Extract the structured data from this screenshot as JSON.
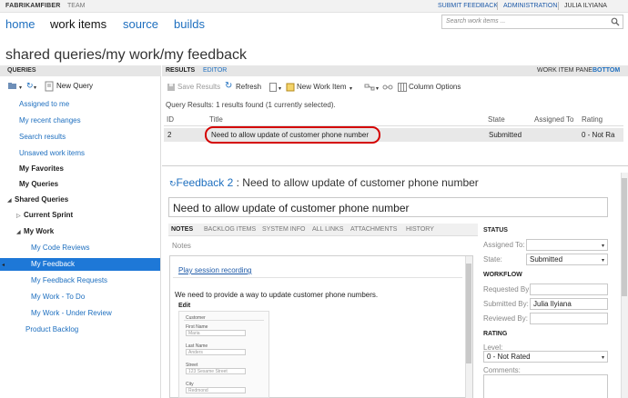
{
  "topbar": {
    "brand": "FABRIKAMFIBER",
    "team": "TEAM",
    "submit_feedback": "SUBMIT FEEDBACK",
    "administration": "ADMINISTRATION",
    "user": "JULIA ILYIANA"
  },
  "nav": {
    "tabs": [
      "home",
      "work items",
      "source",
      "builds"
    ],
    "active_tab": "work items",
    "search_placeholder": "Search work items ..."
  },
  "page_title": "shared queries/my work/my feedback",
  "queries_pane": {
    "header": "QUERIES",
    "new_query_label": "New Query",
    "items": [
      {
        "label": "Assigned to me",
        "style": "link"
      },
      {
        "label": "My recent changes",
        "style": "link"
      },
      {
        "label": "Search results",
        "style": "link"
      },
      {
        "label": "Unsaved work items",
        "style": "link"
      },
      {
        "label": "My Favorites",
        "style": "bold"
      },
      {
        "label": "My Queries",
        "style": "bold"
      },
      {
        "label": "Shared Queries",
        "style": "bold"
      },
      {
        "label": "Current Sprint",
        "style": "bold"
      },
      {
        "label": "My Work",
        "style": "bold"
      },
      {
        "label": "My Code Reviews",
        "style": "link"
      },
      {
        "label": "My Feedback",
        "style": "selected"
      },
      {
        "label": "My Feedback Requests",
        "style": "link"
      },
      {
        "label": "My Work - To Do",
        "style": "link"
      },
      {
        "label": "My Work - Under Review",
        "style": "link"
      },
      {
        "label": "Product Backlog",
        "style": "link"
      }
    ]
  },
  "results": {
    "tab_results": "RESULTS",
    "tab_editor": "EDITOR",
    "pane_label": "WORK ITEM PANE",
    "pane_value": "BOTTOM",
    "toolbar": {
      "save": "Save Results",
      "refresh": "Refresh",
      "new_work_item": "New Work Item",
      "column_options": "Column Options"
    },
    "summary": "Query Results: 1 results found (1 currently selected).",
    "columns": [
      "ID",
      "Title",
      "State",
      "Assigned To",
      "Rating"
    ],
    "rows": [
      {
        "id": "2",
        "title": "Need to allow update of customer phone number",
        "state": "Submitted",
        "assigned": "",
        "rating": "0 - Not Ra"
      }
    ]
  },
  "work_item": {
    "type": "Feedback 2",
    "separator": ":",
    "title": "Need to allow update of customer phone number",
    "tabs": [
      "NOTES",
      "BACKLOG ITEMS",
      "SYSTEM INFO",
      "ALL LINKS",
      "ATTACHMENTS",
      "HISTORY"
    ],
    "active_tab": "NOTES",
    "notes_label": "Notes",
    "play_link": "Play session recording",
    "notes_text": "We need to provide a way to update customer phone numbers.",
    "edit_label": "Edit",
    "screenshot": {
      "heading": "Customer",
      "fields": [
        {
          "label": "First Name",
          "value": "Maria"
        },
        {
          "label": "Last Name",
          "value": "Anders"
        },
        {
          "label": "Street",
          "value": "123 Sesame Street"
        },
        {
          "label": "City",
          "value": "Redmond"
        }
      ]
    },
    "status": {
      "header": "STATUS",
      "assigned_to_label": "Assigned To:",
      "assigned_to_value": "",
      "state_label": "State:",
      "state_value": "Submitted"
    },
    "workflow": {
      "header": "WORKFLOW",
      "requested_by_label": "Requested By:",
      "requested_by_value": "",
      "submitted_by_label": "Submitted By:",
      "submitted_by_value": "Julia Ilyiana",
      "reviewed_by_label": "Reviewed By:",
      "reviewed_by_value": ""
    },
    "rating": {
      "header": "RATING",
      "level_label": "Level:",
      "level_value": "0 - Not Rated",
      "comments_label": "Comments:"
    }
  },
  "colors": {
    "accent": "#1e6fbf",
    "selected": "#1e78d7",
    "highlight_circle": "#d40000"
  }
}
